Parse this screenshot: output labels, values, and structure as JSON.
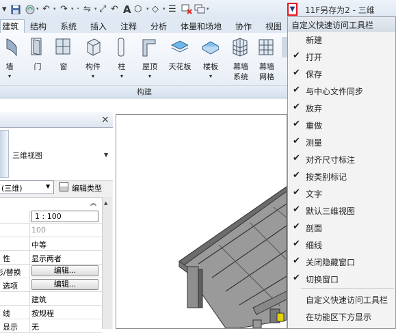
{
  "app": {
    "title": "11F另存为2 - 三维"
  },
  "tabs": [
    "建筑",
    "结构",
    "系统",
    "插入",
    "注释",
    "分析",
    "体量和场地",
    "协作",
    "视图"
  ],
  "ribbon": {
    "panel_label": "构建",
    "buttons": [
      {
        "label": "墙",
        "sub": "",
        "icon": "wall-icon"
      },
      {
        "label": "门",
        "sub": "",
        "icon": "door-icon"
      },
      {
        "label": "窗",
        "sub": "",
        "icon": "window-icon"
      },
      {
        "label": "构件",
        "sub": "",
        "icon": "component-icon"
      },
      {
        "label": "柱",
        "sub": "",
        "icon": "column-icon"
      },
      {
        "label": "屋顶",
        "sub": "",
        "icon": "roof-icon"
      },
      {
        "label": "天花板",
        "sub": "",
        "icon": "ceiling-icon"
      },
      {
        "label": "楼板",
        "sub": "",
        "icon": "floor-icon"
      },
      {
        "label": "幕墙",
        "sub": "系统",
        "icon": "curtain-system-icon"
      },
      {
        "label": "幕墙",
        "sub": "网格",
        "icon": "curtain-grid-icon"
      }
    ]
  },
  "properties": {
    "type_name": "三维视图",
    "filter_value": "(三维)",
    "edit_type_label": "编辑类型",
    "rows": [
      {
        "key": "",
        "value": "1 : 100",
        "kind": "input"
      },
      {
        "key": "",
        "value": "100",
        "kind": "gray"
      },
      {
        "key": "",
        "value": "中等",
        "kind": "text"
      },
      {
        "key": "性",
        "value": "显示两者",
        "kind": "text"
      },
      {
        "key": "形/替换",
        "value": "编辑...",
        "kind": "button"
      },
      {
        "key": "选项",
        "value": "编辑...",
        "kind": "button"
      },
      {
        "key": "",
        "value": "建筑",
        "kind": "text"
      },
      {
        "key": "线",
        "value": "按规程",
        "kind": "text"
      },
      {
        "key": "显示",
        "value": "无",
        "kind": "text"
      }
    ]
  },
  "menu": {
    "title": "自定义快速访问工具栏",
    "items": [
      {
        "label": "新建",
        "checked": false
      },
      {
        "label": "打开",
        "checked": true
      },
      {
        "label": "保存",
        "checked": true
      },
      {
        "label": "与中心文件同步",
        "checked": true
      },
      {
        "label": "放弃",
        "checked": true
      },
      {
        "label": "重做",
        "checked": true
      },
      {
        "label": "测量",
        "checked": true
      },
      {
        "label": "对齐尺寸标注",
        "checked": true
      },
      {
        "label": "按类别标记",
        "checked": true
      },
      {
        "label": "文字",
        "checked": true
      },
      {
        "label": "默认三维视图",
        "checked": true
      },
      {
        "label": "剖面",
        "checked": true
      },
      {
        "label": "细线",
        "checked": true
      },
      {
        "label": "关闭隐藏窗口",
        "checked": true
      },
      {
        "label": "切换窗口",
        "checked": true
      }
    ],
    "bottom_items": [
      "自定义快速访问工具栏",
      "在功能区下方显示"
    ],
    "check_glyph": "✔"
  },
  "colors": {
    "highlight_border": "#e8121c",
    "accent": "#1c3f7a"
  }
}
